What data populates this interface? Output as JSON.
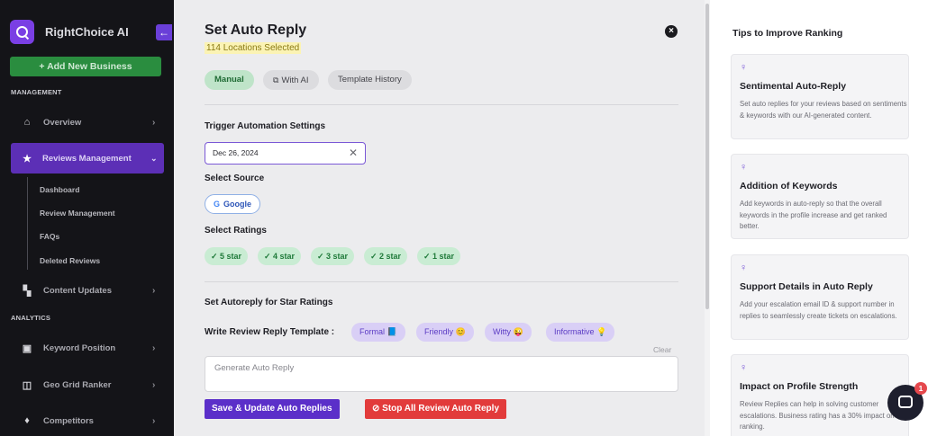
{
  "sidebar": {
    "brand": "RightChoice AI",
    "collapse_icon": "←",
    "add_business": "+ Add New Business",
    "section_management": "MANAGEMENT",
    "section_analytics": "ANALYTICS",
    "items": [
      {
        "label": "Overview",
        "icon": "home-icon"
      },
      {
        "label": "Reviews Management",
        "icon": "star-icon"
      },
      {
        "label": "Content Updates",
        "icon": "content-icon"
      },
      {
        "label": "Keyword Position",
        "icon": "chart-icon"
      },
      {
        "label": "Geo Grid Ranker",
        "icon": "grid-icon"
      },
      {
        "label": "Competitors",
        "icon": "trophy-icon"
      }
    ],
    "sub_items": [
      "Dashboard",
      "Review Management",
      "FAQs",
      "Deleted Reviews"
    ]
  },
  "modal": {
    "title": "Set Auto Reply",
    "subtitle": "114 Locations Selected",
    "tabs": {
      "manual": "Manual",
      "with_ai": "With AI",
      "history": "Template History"
    },
    "trigger_heading": "Trigger Automation Settings",
    "date_value": "Dec 26, 2024",
    "select_source": "Select Source",
    "source_google": "Google",
    "select_ratings": "Select Ratings",
    "ratings": [
      "5 star",
      "4 star",
      "3 star",
      "2 star",
      "1 star"
    ],
    "autoreply_heading": "Set Autoreply for Star Ratings",
    "template_label": "Write Review Reply Template :",
    "templates": [
      "Formal 📘",
      "Friendly 😊",
      "Witty 😜",
      "Informative 💡"
    ],
    "clear": "Clear",
    "textarea_placeholder": "Generate Auto Reply",
    "save_button": "Save & Update Auto Replies",
    "stop_button": "Stop All Review Auto Reply"
  },
  "tips": {
    "title": "Tips to Improve Ranking",
    "cards": [
      {
        "heading": "Sentimental Auto-Reply",
        "text": "Set auto replies for your reviews based on sentiments & keywords with our AI-generated content."
      },
      {
        "heading": "Addition of Keywords",
        "text": "Add keywords in auto-reply so that the overall keywords in the profile increase and get ranked better."
      },
      {
        "heading": "Support Details in Auto Reply",
        "text": "Add your escalation email ID & support number in replies to seamlessly create tickets on escalations."
      },
      {
        "heading": "Impact on Profile Strength",
        "text": "Review Replies can help in solving customer escalations. Business rating has a 30% impact on ranking."
      }
    ]
  },
  "chat": {
    "badge": "1"
  },
  "colors": {
    "accent": "#5b2fc9",
    "success": "#2a8d3f",
    "danger": "#e23b3b"
  }
}
